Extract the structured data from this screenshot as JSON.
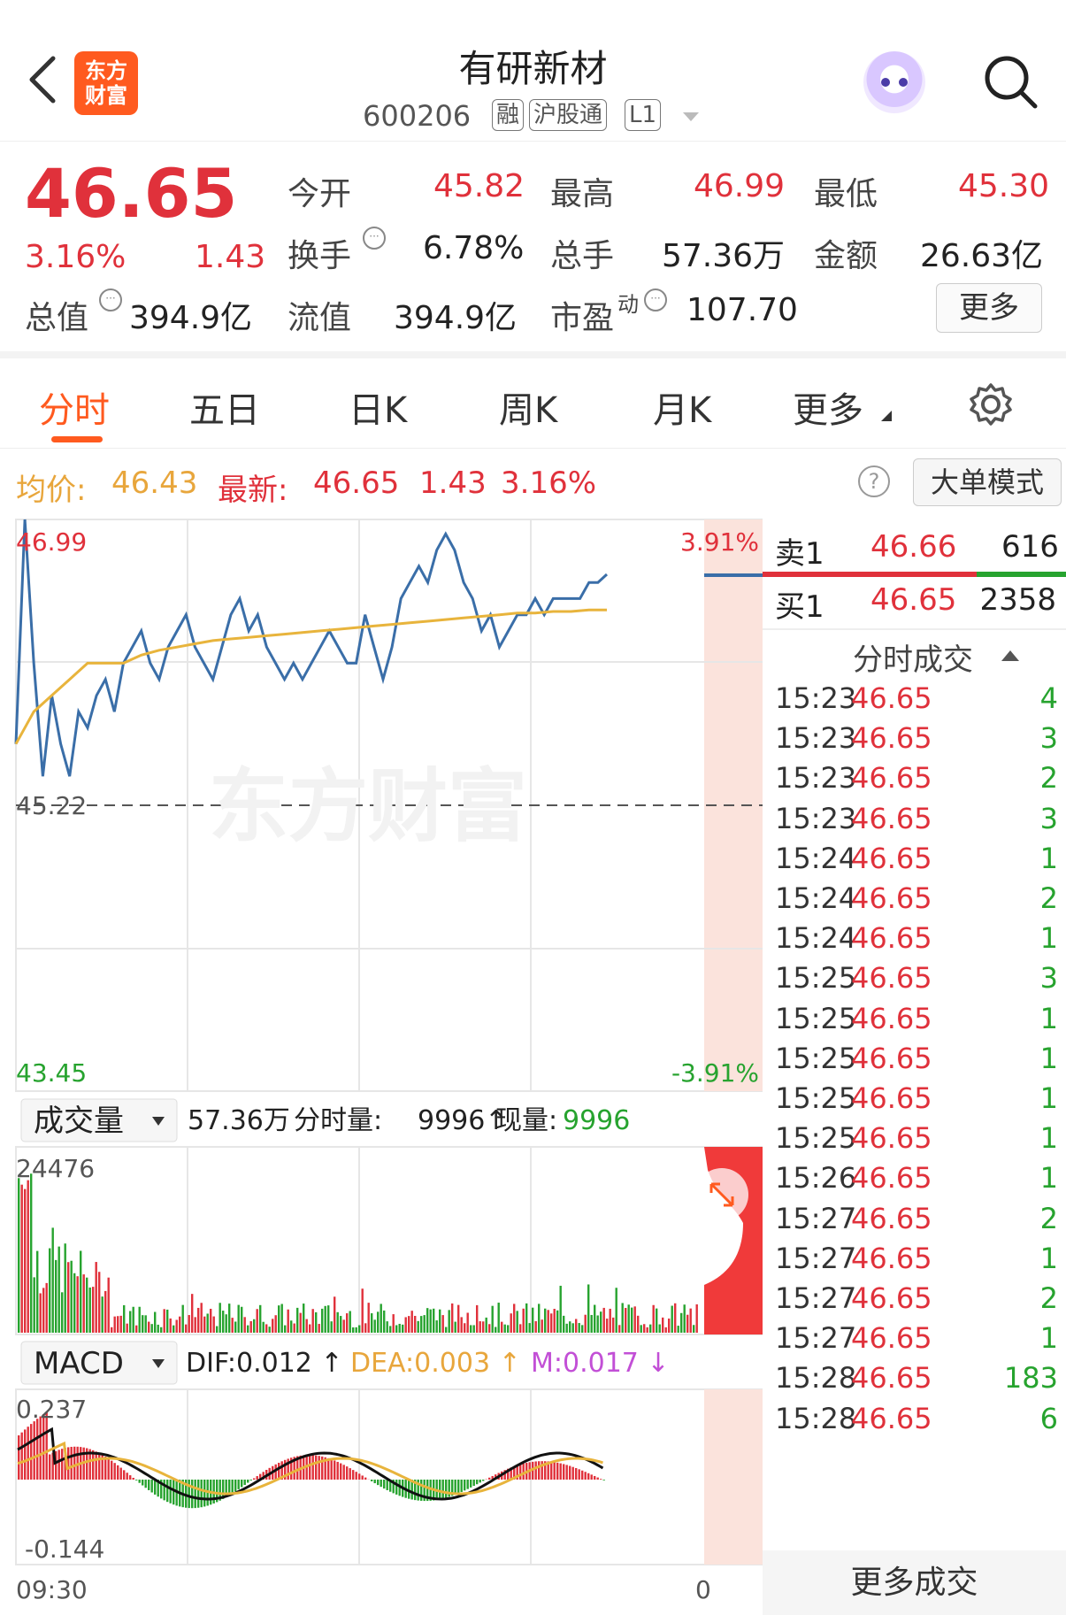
{
  "header": {
    "logo_text": "东方财富",
    "title": "有研新材",
    "code": "600206",
    "tags": [
      "融",
      "沪股通",
      "L1"
    ]
  },
  "quote": {
    "price": "46.65",
    "change_pct": "3.16%",
    "change": "1.43",
    "open_label": "今开",
    "open": "45.82",
    "high_label": "最高",
    "high": "46.99",
    "low_label": "最低",
    "low": "45.30",
    "turnover_label": "换手",
    "turnover": "6.78%",
    "volume_label": "总手",
    "volume": "57.36万",
    "amount_label": "金额",
    "amount": "26.63亿",
    "mktcap_label": "总值",
    "mktcap": "394.9亿",
    "float_label": "流值",
    "float": "394.9亿",
    "pe_label": "市盈",
    "pe_sup": "动",
    "pe": "107.70",
    "more_label": "更多"
  },
  "tabs": [
    {
      "label": "分时",
      "active": true
    },
    {
      "label": "五日"
    },
    {
      "label": "日K"
    },
    {
      "label": "周K"
    },
    {
      "label": "月K"
    },
    {
      "label": "更多"
    }
  ],
  "infobar": {
    "avg_label": "均价:",
    "avg": "46.43",
    "latest_label": "最新:",
    "latest": "46.65",
    "change": "1.43",
    "change_pct": "3.16%",
    "bigorder_label": "大单模式"
  },
  "chart_labels": {
    "price_high": "46.99",
    "price_mid": "45.22",
    "price_low": "43.45",
    "pct_high": "3.91%",
    "pct_low": "-3.91%",
    "watermark": "东方财富",
    "volume_selector": "成交量",
    "volume_total": "57.36万",
    "volume_fenshi_label": "分时量:",
    "volume_fenshi": "9996",
    "volume_now_label": "现量:",
    "volume_now": "9996",
    "volume_max": "24476",
    "macd_selector": "MACD",
    "dif": "DIF:0.012 ↑",
    "dea": "DEA:0.003 ↑",
    "m": "M:0.017 ↓",
    "macd_max": "0.237",
    "macd_min": "-0.144",
    "time_start": "09:30",
    "time_end": "0"
  },
  "orderbook": {
    "sell1_label": "卖1",
    "sell1_price": "46.66",
    "sell1_vol": "616",
    "buy1_label": "买1",
    "buy1_price": "46.65",
    "buy1_vol": "2358"
  },
  "trades": {
    "title": "分时成交",
    "more_label": "更多成交",
    "rows": [
      {
        "time": "15:23",
        "price": "46.65",
        "vol": "4"
      },
      {
        "time": "15:23",
        "price": "46.65",
        "vol": "3"
      },
      {
        "time": "15:23",
        "price": "46.65",
        "vol": "2"
      },
      {
        "time": "15:23",
        "price": "46.65",
        "vol": "3"
      },
      {
        "time": "15:24",
        "price": "46.65",
        "vol": "1"
      },
      {
        "time": "15:24",
        "price": "46.65",
        "vol": "2"
      },
      {
        "time": "15:24",
        "price": "46.65",
        "vol": "1"
      },
      {
        "time": "15:25",
        "price": "46.65",
        "vol": "3"
      },
      {
        "time": "15:25",
        "price": "46.65",
        "vol": "1"
      },
      {
        "time": "15:25",
        "price": "46.65",
        "vol": "1"
      },
      {
        "time": "15:25",
        "price": "46.65",
        "vol": "1"
      },
      {
        "time": "15:25",
        "price": "46.65",
        "vol": "1"
      },
      {
        "time": "15:26",
        "price": "46.65",
        "vol": "1"
      },
      {
        "time": "15:27",
        "price": "46.65",
        "vol": "2"
      },
      {
        "time": "15:27",
        "price": "46.65",
        "vol": "1"
      },
      {
        "time": "15:27",
        "price": "46.65",
        "vol": "2"
      },
      {
        "time": "15:27",
        "price": "46.65",
        "vol": "1"
      },
      {
        "time": "15:28",
        "price": "46.65",
        "vol": "183"
      },
      {
        "time": "15:28",
        "price": "46.65",
        "vol": "6"
      }
    ]
  },
  "chart_data": {
    "type": "line",
    "ylim": [
      43.45,
      46.99
    ],
    "baseline": 45.22,
    "series": [
      {
        "values": [
          45.6,
          46.99,
          46.1,
          45.4,
          45.9,
          45.6,
          45.4,
          45.8,
          45.7,
          45.9,
          46.0,
          45.8,
          46.1,
          46.2,
          46.3,
          46.1,
          46.0,
          46.2,
          46.3,
          46.4,
          46.2,
          46.1,
          46.0,
          46.2,
          46.4,
          46.5,
          46.3,
          46.4,
          46.2,
          46.1,
          46.0,
          46.1,
          46.0,
          46.1,
          46.2,
          46.3,
          46.2,
          46.1,
          46.1,
          46.4,
          46.2,
          46.0,
          46.2,
          46.5,
          46.6,
          46.7,
          46.6,
          46.8,
          46.9,
          46.8,
          46.6,
          46.5,
          46.3,
          46.4,
          46.2,
          46.3,
          46.4,
          46.4,
          46.5,
          46.4,
          46.5,
          46.5,
          46.5,
          46.5,
          46.6,
          46.6,
          46.65
        ]
      },
      {
        "values": [
          45.6,
          45.8,
          45.9,
          46.0,
          46.1,
          46.1,
          46.1,
          46.15,
          46.18,
          46.2,
          46.22,
          46.24,
          46.25,
          46.26,
          46.27,
          46.28,
          46.29,
          46.3,
          46.31,
          46.32,
          46.33,
          46.34,
          46.35,
          46.36,
          46.37,
          46.38,
          46.39,
          46.4,
          46.41,
          46.41,
          46.42,
          46.42,
          46.43,
          46.43
        ]
      }
    ]
  }
}
